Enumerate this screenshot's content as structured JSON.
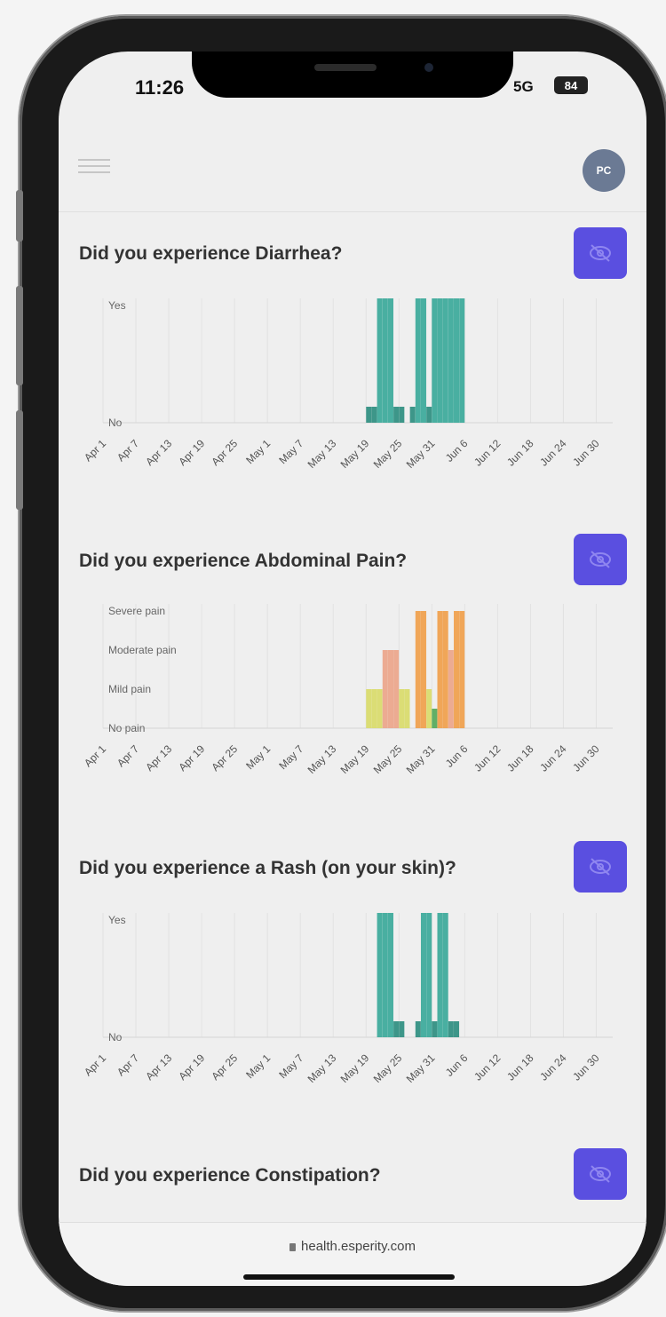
{
  "status_bar": {
    "time": "11:26",
    "network": "5G",
    "battery": "84"
  },
  "header": {
    "menu_icon": "hamburger-menu-icon",
    "avatar_initials": "PC"
  },
  "colors": {
    "accent": "#5a4fe0",
    "teal": "#3ba99a",
    "teal_dark": "#2e8e80",
    "pain_mild": "#d9db6a",
    "pain_moderate": "#eba58a",
    "pain_severe": "#f0a04b",
    "pain_none_green": "#55a95a"
  },
  "questions": [
    {
      "title": "Did you experience Diarrhea?",
      "hide_icon": "eye-off-icon"
    },
    {
      "title": "Did you experience Abdominal Pain?",
      "hide_icon": "eye-off-icon"
    },
    {
      "title": "Did you experience a Rash (on your skin)?",
      "hide_icon": "eye-off-icon"
    },
    {
      "title": "Did you experience Constipation?",
      "hide_icon": "eye-off-icon"
    }
  ],
  "chart_data": [
    {
      "type": "bar",
      "title": "Did you experience Diarrhea?",
      "x_ticks": [
        "Apr 1",
        "Apr 7",
        "Apr 13",
        "Apr 19",
        "Apr 25",
        "May 1",
        "May 7",
        "May 13",
        "May 19",
        "May 25",
        "May 31",
        "Jun 6",
        "Jun 12",
        "Jun 18",
        "Jun 24",
        "Jun 30"
      ],
      "y_ticks": [
        "No",
        "Yes"
      ],
      "xlim": [
        "2024-04-01",
        "2024-07-03"
      ],
      "grid": true,
      "series": [
        {
          "values": [
            {
              "x": "2024-05-19",
              "y": "No"
            },
            {
              "x": "2024-05-20",
              "y": "No"
            },
            {
              "x": "2024-05-21",
              "y": "Yes"
            },
            {
              "x": "2024-05-22",
              "y": "Yes"
            },
            {
              "x": "2024-05-23",
              "y": "Yes"
            },
            {
              "x": "2024-05-24",
              "y": "No"
            },
            {
              "x": "2024-05-25",
              "y": "No"
            },
            {
              "x": "2024-05-27",
              "y": "No"
            },
            {
              "x": "2024-05-28",
              "y": "Yes"
            },
            {
              "x": "2024-05-29",
              "y": "Yes"
            },
            {
              "x": "2024-05-30",
              "y": "No"
            },
            {
              "x": "2024-05-31",
              "y": "Yes"
            },
            {
              "x": "2024-06-01",
              "y": "Yes"
            },
            {
              "x": "2024-06-02",
              "y": "Yes"
            },
            {
              "x": "2024-06-03",
              "y": "Yes"
            },
            {
              "x": "2024-06-04",
              "y": "Yes"
            },
            {
              "x": "2024-06-05",
              "y": "Yes"
            }
          ]
        }
      ]
    },
    {
      "type": "bar",
      "title": "Did you experience Abdominal Pain?",
      "x_ticks": [
        "Apr 1",
        "Apr 7",
        "Apr 13",
        "Apr 19",
        "Apr 25",
        "May 1",
        "May 7",
        "May 13",
        "May 19",
        "May 25",
        "May 31",
        "Jun 6",
        "Jun 12",
        "Jun 18",
        "Jun 24",
        "Jun 30"
      ],
      "y_ticks": [
        "No pain",
        "Mild pain",
        "Moderate pain",
        "Severe pain"
      ],
      "xlim": [
        "2024-04-01",
        "2024-07-03"
      ],
      "grid": true,
      "series": [
        {
          "values": [
            {
              "x": "2024-05-19",
              "y": "Mild pain"
            },
            {
              "x": "2024-05-20",
              "y": "Mild pain"
            },
            {
              "x": "2024-05-21",
              "y": "Mild pain"
            },
            {
              "x": "2024-05-22",
              "y": "Moderate pain"
            },
            {
              "x": "2024-05-23",
              "y": "Moderate pain"
            },
            {
              "x": "2024-05-24",
              "y": "Moderate pain"
            },
            {
              "x": "2024-05-25",
              "y": "Mild pain"
            },
            {
              "x": "2024-05-26",
              "y": "Mild pain"
            },
            {
              "x": "2024-05-28",
              "y": "Severe pain"
            },
            {
              "x": "2024-05-29",
              "y": "Severe pain"
            },
            {
              "x": "2024-05-30",
              "y": "Mild pain"
            },
            {
              "x": "2024-05-31",
              "y": "No pain"
            },
            {
              "x": "2024-06-01",
              "y": "Severe pain"
            },
            {
              "x": "2024-06-02",
              "y": "Severe pain"
            },
            {
              "x": "2024-06-03",
              "y": "Moderate pain"
            },
            {
              "x": "2024-06-04",
              "y": "Severe pain"
            },
            {
              "x": "2024-06-05",
              "y": "Severe pain"
            }
          ]
        }
      ]
    },
    {
      "type": "bar",
      "title": "Did you experience a Rash (on your skin)?",
      "x_ticks": [
        "Apr 1",
        "Apr 7",
        "Apr 13",
        "Apr 19",
        "Apr 25",
        "May 1",
        "May 7",
        "May 13",
        "May 19",
        "May 25",
        "May 31",
        "Jun 6",
        "Jun 12",
        "Jun 18",
        "Jun 24",
        "Jun 30"
      ],
      "y_ticks": [
        "No",
        "Yes"
      ],
      "xlim": [
        "2024-04-01",
        "2024-07-03"
      ],
      "grid": true,
      "series": [
        {
          "values": [
            {
              "x": "2024-05-21",
              "y": "Yes"
            },
            {
              "x": "2024-05-22",
              "y": "Yes"
            },
            {
              "x": "2024-05-23",
              "y": "Yes"
            },
            {
              "x": "2024-05-24",
              "y": "No"
            },
            {
              "x": "2024-05-25",
              "y": "No"
            },
            {
              "x": "2024-05-28",
              "y": "No"
            },
            {
              "x": "2024-05-29",
              "y": "Yes"
            },
            {
              "x": "2024-05-30",
              "y": "Yes"
            },
            {
              "x": "2024-05-31",
              "y": "No"
            },
            {
              "x": "2024-06-01",
              "y": "Yes"
            },
            {
              "x": "2024-06-02",
              "y": "Yes"
            },
            {
              "x": "2024-06-03",
              "y": "No"
            },
            {
              "x": "2024-06-04",
              "y": "No"
            }
          ]
        }
      ]
    }
  ],
  "browser": {
    "url": "health.esperity.com",
    "lock_icon": "lock-icon"
  }
}
